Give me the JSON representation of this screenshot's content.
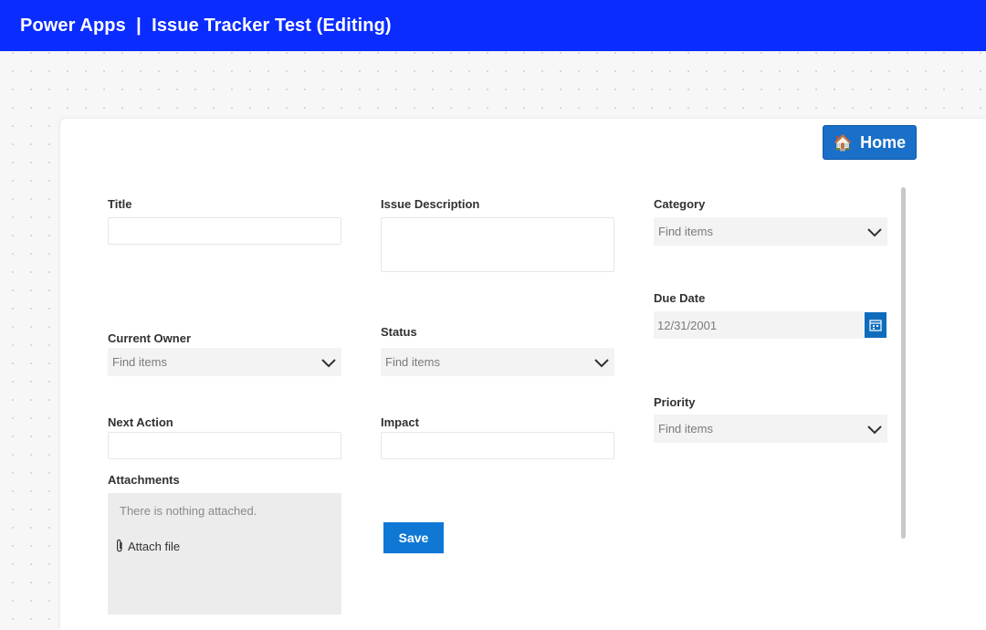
{
  "header": {
    "title": "Power Apps  |  Issue Tracker Test (Editing)"
  },
  "home_button": {
    "icon": "house-icon",
    "label": "Home"
  },
  "form": {
    "title": {
      "label": "Title",
      "value": ""
    },
    "issue_description": {
      "label": "Issue Description",
      "value": ""
    },
    "category": {
      "label": "Category",
      "placeholder": "Find items"
    },
    "due_date": {
      "label": "Due Date",
      "value": "12/31/2001"
    },
    "current_owner": {
      "label": "Current Owner",
      "placeholder": "Find items"
    },
    "status": {
      "label": "Status",
      "placeholder": "Find items"
    },
    "priority": {
      "label": "Priority",
      "placeholder": "Find items"
    },
    "next_action": {
      "label": "Next Action",
      "value": ""
    },
    "impact": {
      "label": "Impact",
      "value": ""
    },
    "attachments": {
      "label": "Attachments",
      "empty_text": "There is nothing attached.",
      "attach_label": "Attach file"
    },
    "save_label": "Save"
  },
  "colors": {
    "header_bg": "#0a2cff",
    "accent": "#0f78d4",
    "home_button_bg": "#1a6fc8"
  }
}
